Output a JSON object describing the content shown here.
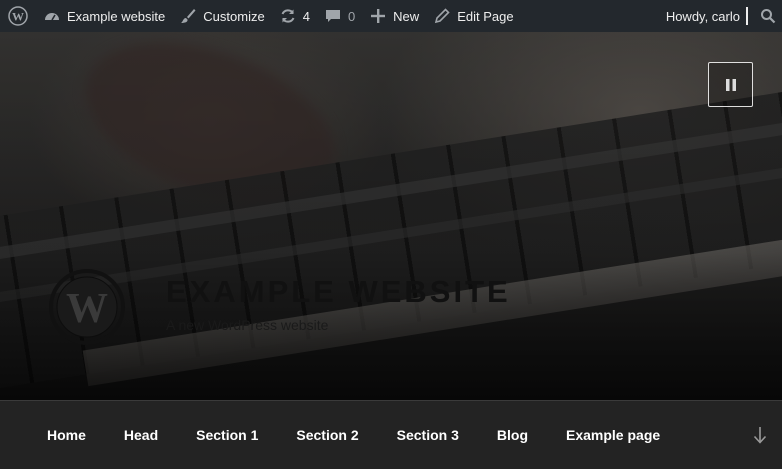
{
  "admin_bar": {
    "wp_logo_icon": "wordpress-icon",
    "site_name": "Example website",
    "customize": "Customize",
    "updates_count": "4",
    "comments_count": "0",
    "new_label": "New",
    "edit_page": "Edit Page",
    "howdy": "Howdy, carlo"
  },
  "hero": {
    "site_title": "EXAMPLE WEBSITE",
    "site_description": "A new WordPress website",
    "pause_icon": "pause-icon"
  },
  "nav": {
    "items": [
      "Home",
      "Head",
      "Section 1",
      "Section 2",
      "Section 3",
      "Blog",
      "Example page"
    ],
    "scroll_icon": "arrow-down-icon"
  }
}
